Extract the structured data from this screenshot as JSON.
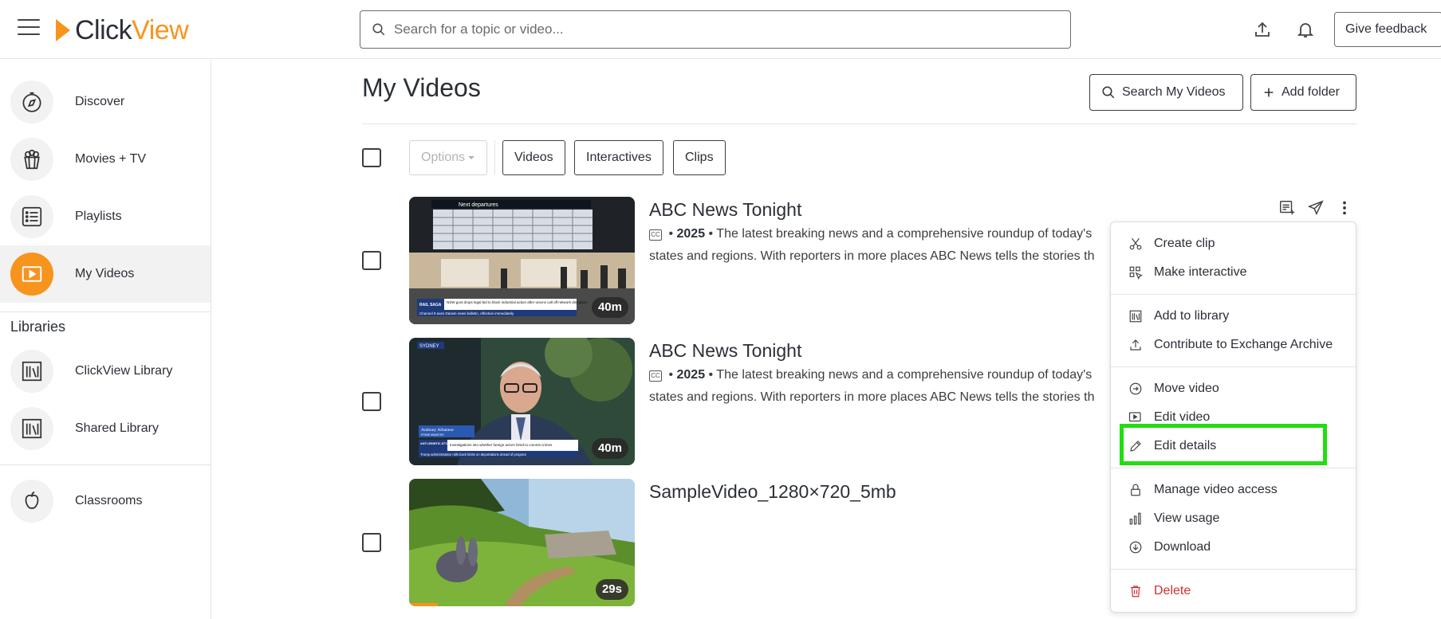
{
  "header": {
    "logo_click": "Click",
    "logo_view": "View",
    "search_placeholder": "Search for a topic or video...",
    "feedback_label": "Give feedback"
  },
  "sidebar": {
    "items": [
      {
        "label": "Discover",
        "icon": "compass-icon"
      },
      {
        "label": "Movies + TV",
        "icon": "popcorn-icon"
      },
      {
        "label": "Playlists",
        "icon": "list-icon"
      },
      {
        "label": "My Videos",
        "icon": "play-icon",
        "active": true
      }
    ],
    "libraries_heading": "Libraries",
    "libraries": [
      {
        "label": "ClickView Library",
        "icon": "library-icon"
      },
      {
        "label": "Shared Library",
        "icon": "library-icon"
      }
    ],
    "classrooms_label": "Classrooms"
  },
  "main": {
    "title": "My Videos",
    "search_my_videos": "Search My Videos",
    "add_folder": "Add folder",
    "options_label": "Options",
    "filters": [
      "Videos",
      "Interactives",
      "Clips"
    ],
    "videos": [
      {
        "title": "ABC News Tonight",
        "year": "2025",
        "description_line1": "The latest breaking news and a comprehensive roundup of today's",
        "description_line2": "states and regions. With reporters in more places ABC News tells the stories th",
        "duration": "40m",
        "cc": "CC"
      },
      {
        "title": "ABC News Tonight",
        "year": "2025",
        "description_line1": "The latest breaking news and a comprehensive roundup of today's",
        "description_line2": "states and regions. With reporters in more places ABC News tells the stories th",
        "duration": "40m",
        "cc": "CC"
      },
      {
        "title": "SampleVideo_1280×720_5mb",
        "duration": "29s"
      }
    ],
    "thumb_text": {
      "v1_banner": "Next departures",
      "v1_ticker_tag": "RAIL SAGA",
      "v1_ticker": "NSW govt drops legal bid to block industrial action after unions call off network disruption",
      "v1_ticker2": "Channel 9 axes Darwin news bulletin, effective immediately",
      "v2_loc": "SYDNEY",
      "v2_name": "Anthony Albanese",
      "v2_role": "PRIME MINISTER",
      "v2_tag": "ANTI-SEMITIC ATTACKS",
      "v2_ticker": "Investigations into whether foreign actors hired to commit crimes",
      "v2_ticker2": "Trump administration rolls back limits on deportations ahead of program"
    }
  },
  "context_menu": {
    "items": [
      {
        "label": "Create clip",
        "icon": "scissors-icon"
      },
      {
        "label": "Make interactive",
        "icon": "interactive-icon"
      },
      {
        "label": "Add to library",
        "icon": "library-icon"
      },
      {
        "label": "Contribute to Exchange Archive",
        "icon": "upload-icon"
      },
      {
        "label": "Move video",
        "icon": "move-icon"
      },
      {
        "label": "Edit video",
        "icon": "edit-video-icon"
      },
      {
        "label": "Edit details",
        "icon": "pencil-icon"
      },
      {
        "label": "Manage video access",
        "icon": "lock-icon"
      },
      {
        "label": "View usage",
        "icon": "bar-chart-icon"
      },
      {
        "label": "Download",
        "icon": "download-icon"
      },
      {
        "label": "Delete",
        "icon": "trash-icon"
      }
    ]
  },
  "colors": {
    "brand_orange": "#f7941d",
    "highlight_green": "#22dd11",
    "danger_red": "#d32f2f"
  }
}
